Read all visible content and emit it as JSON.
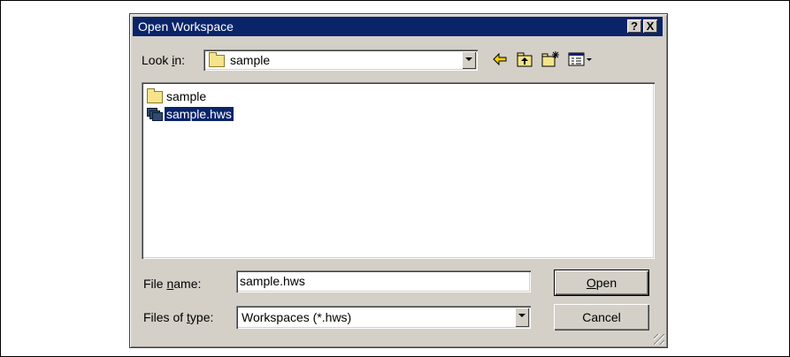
{
  "dialog": {
    "title": "Open Workspace",
    "help_button": "?",
    "close_button": "X"
  },
  "lookin": {
    "label_prefix": "Look ",
    "label_accel": "i",
    "label_suffix": "n:",
    "value": "sample"
  },
  "toolbar": {
    "back_icon": "back-arrow-icon",
    "up_icon": "up-one-level-icon",
    "new_folder_icon": "new-folder-icon",
    "view_icon": "view-menu-icon"
  },
  "files": [
    {
      "name": "sample",
      "type": "folder",
      "selected": false
    },
    {
      "name": "sample.hws",
      "type": "workspace",
      "selected": true
    }
  ],
  "filename": {
    "label_prefix": "File ",
    "label_accel": "n",
    "label_suffix": "ame:",
    "value": "sample.hws"
  },
  "filetype": {
    "label_prefix": "Files of ",
    "label_accel": "t",
    "label_suffix": "ype:",
    "value": "Workspaces (*.hws)"
  },
  "buttons": {
    "open_accel": "O",
    "open_rest": "pen",
    "cancel": "Cancel"
  },
  "colors": {
    "titlebar": "#0a246a",
    "face": "#d4d0c8",
    "selection": "#0a246a"
  }
}
